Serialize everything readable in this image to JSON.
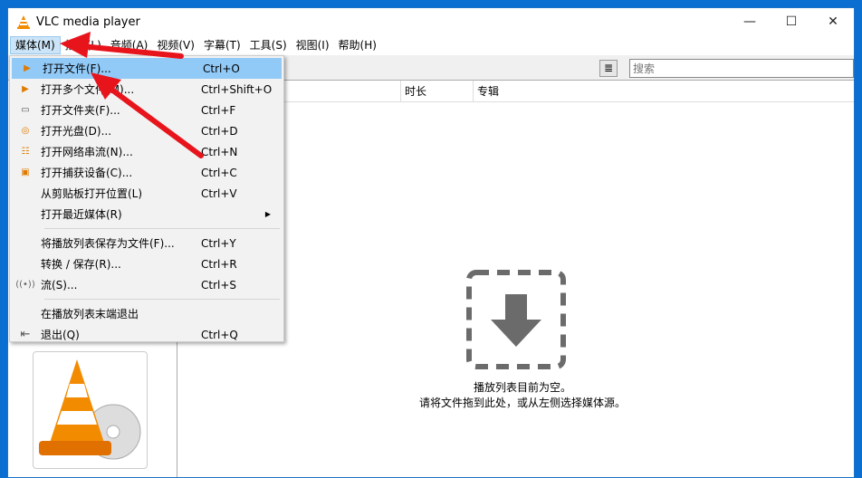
{
  "window": {
    "title": "VLC media player",
    "minimize": "—",
    "maximize": "☐",
    "close": "✕"
  },
  "menubar": [
    "媒体(M)",
    "播放(L)",
    "音频(A)",
    "视频(V)",
    "字幕(T)",
    "工具(S)",
    "视图(I)",
    "帮助(H)"
  ],
  "toolbar": {
    "search_placeholder": "搜索",
    "list_icon": "≣"
  },
  "columns": [
    "时长",
    "专辑"
  ],
  "empty": {
    "line1": "播放列表目前为空。",
    "line2": "请将文件拖到此处，或从左侧选择媒体源。"
  },
  "media_menu": [
    {
      "label": "打开文件(F)...",
      "shortcut": "Ctrl+O",
      "icon": "file-play-icon"
    },
    {
      "label": "打开多个文件(M)...",
      "shortcut": "Ctrl+Shift+O",
      "icon": "files-play-icon"
    },
    {
      "label": "打开文件夹(F)...",
      "shortcut": "Ctrl+F",
      "icon": "folder-icon"
    },
    {
      "label": "打开光盘(D)...",
      "shortcut": "Ctrl+D",
      "icon": "disc-icon"
    },
    {
      "label": "打开网络串流(N)...",
      "shortcut": "Ctrl+N",
      "icon": "network-icon"
    },
    {
      "label": "打开捕获设备(C)...",
      "shortcut": "Ctrl+C",
      "icon": "capture-icon"
    },
    {
      "label": "从剪贴板打开位置(L)",
      "shortcut": "Ctrl+V",
      "icon": ""
    },
    {
      "label": "打开最近媒体(R)",
      "shortcut": "",
      "icon": ""
    },
    {
      "label": "将播放列表保存为文件(F)...",
      "shortcut": "Ctrl+Y",
      "icon": ""
    },
    {
      "label": "转换 / 保存(R)...",
      "shortcut": "Ctrl+R",
      "icon": ""
    },
    {
      "label": "流(S)...",
      "shortcut": "Ctrl+S",
      "icon": "stream-icon"
    },
    {
      "label": "在播放列表末端退出",
      "shortcut": "",
      "icon": ""
    },
    {
      "label": "退出(Q)",
      "shortcut": "Ctrl+Q",
      "icon": "exit-icon"
    }
  ],
  "colors": {
    "highlight": "#91c9f7",
    "arrow": "#e8141c",
    "vlc_orange": "#f28b00"
  }
}
